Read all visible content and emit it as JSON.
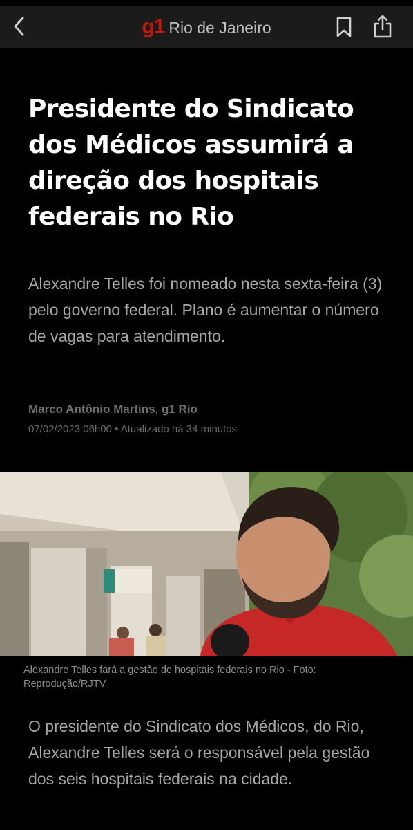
{
  "header": {
    "brand": "g1",
    "section": "Rio de Janeiro",
    "icons": [
      "chevron-left-icon",
      "bookmark-icon",
      "share-icon"
    ]
  },
  "article": {
    "headline": "Presidente do Sindicato dos Médicos assumirá a direção dos hospitais federais no Rio",
    "subtitle": "Alexandre Telles foi nomeado nesta sexta-feira (3) pelo governo federal. Plano é aumentar o número de vagas para atendimento.",
    "byline": "Marco Antônio Martins, g1 Rio",
    "dateline": "07/02/2023 06h00 • Atualizado há 34 minutos",
    "photo_caption": "Alexandre Telles fará a gestão de hospitais federais no Rio - Foto: Reprodução/RJTV",
    "body": "O presidente do Sindicato dos Médicos, do Rio, Alexandre Telles será o responsável pela gestão dos seis hospitais federais na cidade."
  },
  "colors": {
    "brand_red": "#c4170c",
    "background": "#000000",
    "navbar": "#1b1b1b",
    "subtitle_gray": "#a7a7a7"
  }
}
